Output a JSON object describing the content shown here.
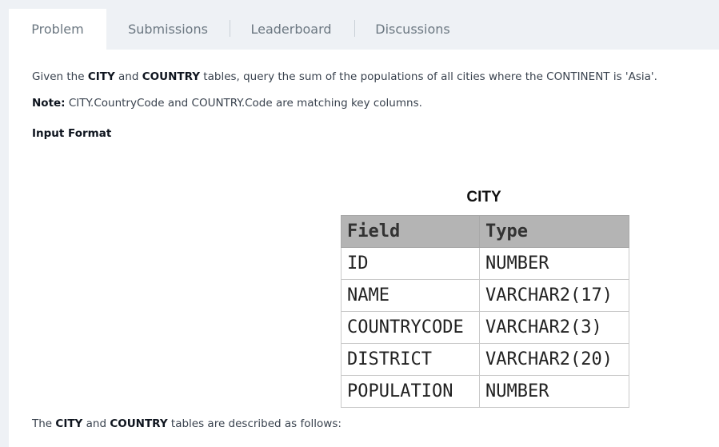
{
  "tabs": {
    "problem": "Problem",
    "submissions": "Submissions",
    "leaderboard": "Leaderboard",
    "discussions": "Discussions"
  },
  "statement": {
    "p1_a": "Given the ",
    "p1_city": "CITY",
    "p1_b": " and ",
    "p1_country": "COUNTRY",
    "p1_c": " tables, query the sum of the populations of all cities where the CONTINENT is 'Asia'.",
    "note_label": "Note:",
    "note_text": " CITY.CountryCode and COUNTRY.Code are matching key columns.",
    "input_format": "Input Format",
    "desc_a": "The ",
    "desc_city": "CITY",
    "desc_b": " and ",
    "desc_country": "COUNTRY",
    "desc_c": " tables are described as follows:"
  },
  "city_table": {
    "title": "CITY",
    "headers": [
      "Field",
      "Type"
    ],
    "rows": [
      [
        "ID",
        "NUMBER"
      ],
      [
        "NAME",
        "VARCHAR2(17)"
      ],
      [
        "COUNTRYCODE",
        "VARCHAR2(3)"
      ],
      [
        "DISTRICT",
        "VARCHAR2(20)"
      ],
      [
        "POPULATION",
        "NUMBER"
      ]
    ]
  }
}
